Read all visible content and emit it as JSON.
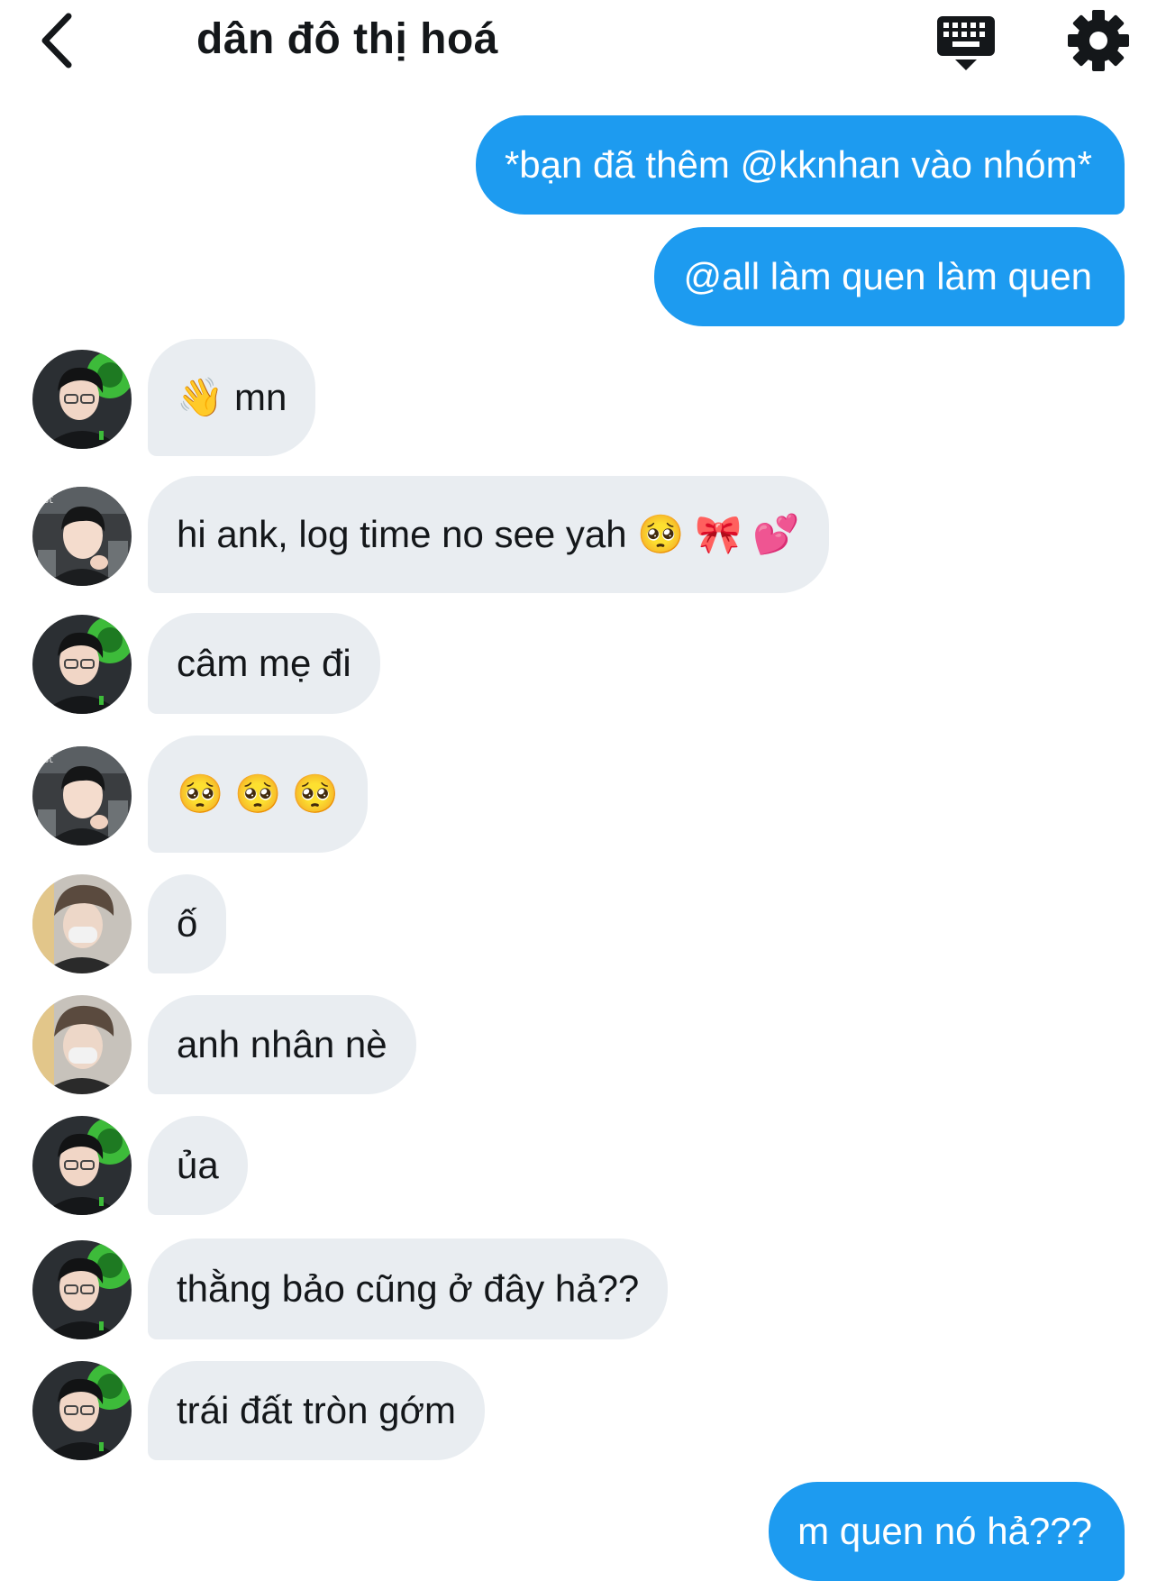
{
  "header": {
    "title": "dân đô thị hoá",
    "back_icon": "chevron-left-icon",
    "keyboard_icon": "keyboard-icon",
    "settings_icon": "gear-icon"
  },
  "messages": [
    {
      "dir": "out",
      "text": "*bạn đã thêm @kknhan vào nhóm*"
    },
    {
      "dir": "out",
      "text": "@all làm quen làm quen"
    },
    {
      "dir": "in",
      "avatar": "a",
      "text": "👋  mn"
    },
    {
      "dir": "in",
      "avatar": "b",
      "text": "hi ank, log time no see yah 🥺 🎀 💕"
    },
    {
      "dir": "in",
      "avatar": "a",
      "text": "câm mẹ đi"
    },
    {
      "dir": "in",
      "avatar": "b",
      "text": "🥺 🥺 🥺"
    },
    {
      "dir": "in",
      "avatar": "c",
      "text": "ố"
    },
    {
      "dir": "in",
      "avatar": "c",
      "text": "anh nhân nè"
    },
    {
      "dir": "in",
      "avatar": "a",
      "text": "ủa"
    },
    {
      "dir": "in",
      "avatar": "a",
      "text": "thằng bảo cũng ở đây hả??"
    },
    {
      "dir": "in",
      "avatar": "a",
      "text": "trái đất tròn gớm"
    },
    {
      "dir": "out",
      "text": "m quen nó hả???"
    }
  ],
  "colors": {
    "outgoing_bubble": "#1d9bf0",
    "incoming_bubble": "#e9edf1",
    "text": "#14171a"
  }
}
